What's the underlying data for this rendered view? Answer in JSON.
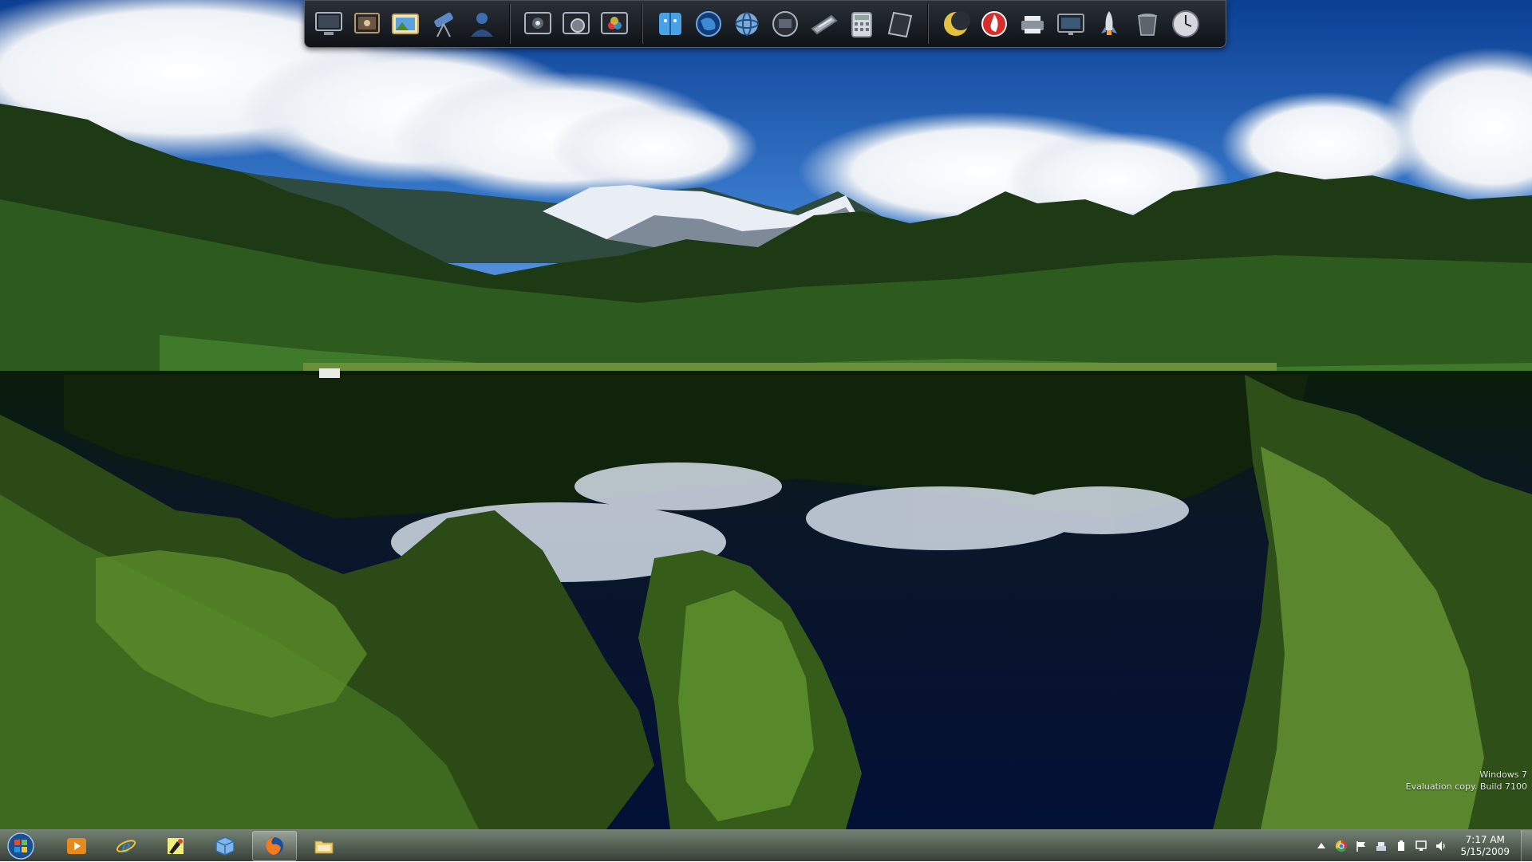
{
  "desktop": {
    "wallpaper": "lake-mountain-forest-reflection",
    "watermark": {
      "line1": "Windows 7",
      "line2": "Evaluation copy. Build 7100"
    }
  },
  "dock": {
    "groups": [
      [
        "monitor-icon",
        "slideshow-icon",
        "photo-viewer-icon",
        "telescope-icon",
        "user-icon"
      ],
      [
        "media-frame-icon",
        "media-settings-icon",
        "media-color-icon"
      ],
      [
        "finder-icon",
        "globe-icon",
        "internet-icon",
        "screen-icon",
        "scanner-icon",
        "calculator-icon",
        "notepad-icon"
      ],
      [
        "moon-icon",
        "burn-icon",
        "printer-icon",
        "display-icon",
        "rocket-icon",
        "trash-icon",
        "clock-icon"
      ]
    ]
  },
  "taskbar": {
    "start": "start-orb-icon",
    "pinned": [
      {
        "name": "media-player-icon",
        "active": false
      },
      {
        "name": "internet-explorer-icon",
        "active": false
      },
      {
        "name": "paint-icon",
        "active": false
      },
      {
        "name": "package-icon",
        "active": false
      },
      {
        "name": "firefox-icon",
        "active": true
      },
      {
        "name": "folder-icon",
        "active": false
      }
    ],
    "tray": [
      "arrow-up-icon",
      "chrome-icon",
      "flag-icon",
      "network-icon",
      "power-icon",
      "device-icon",
      "speaker-icon"
    ],
    "clock": {
      "time": "7:17 AM",
      "date": "5/15/2009"
    }
  }
}
